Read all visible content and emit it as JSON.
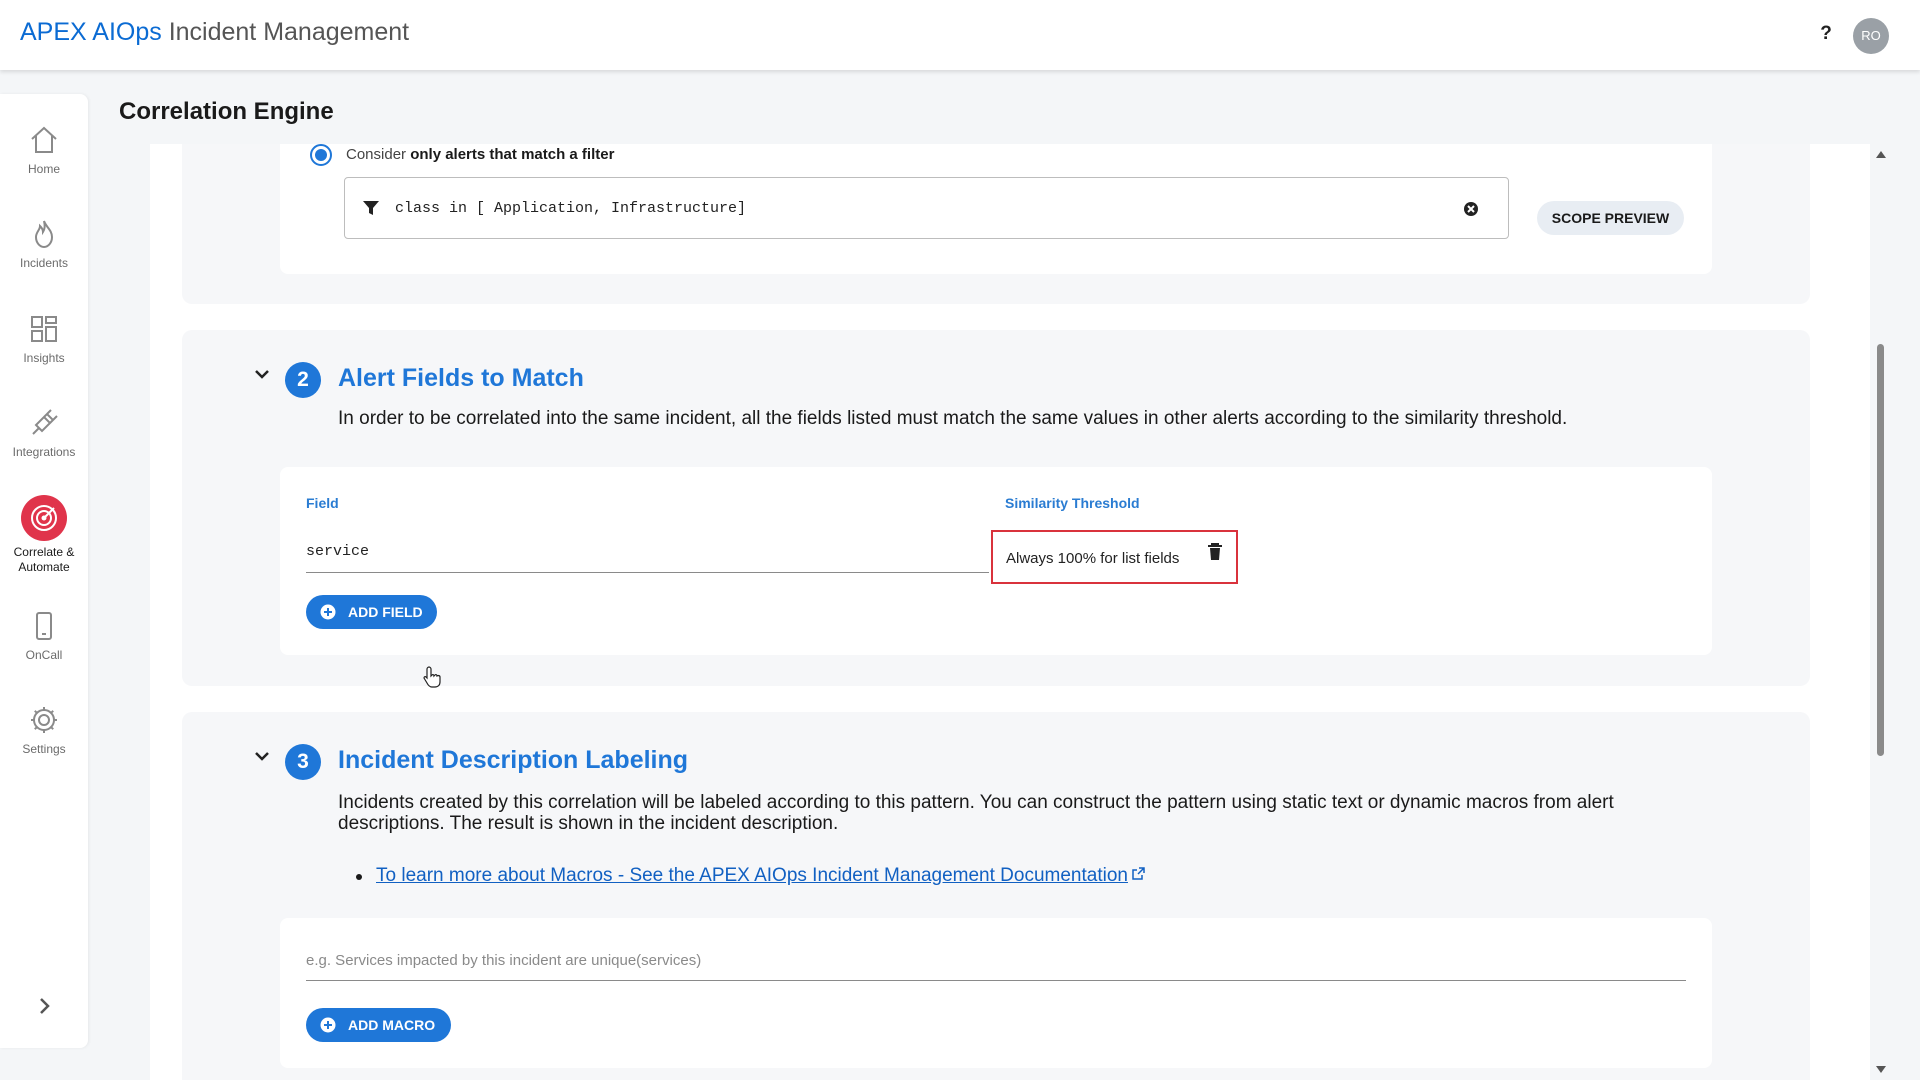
{
  "header": {
    "brand_primary": "APEX AIOps",
    "brand_secondary": " Incident Management",
    "help": "?",
    "avatar": "RO"
  },
  "sidebar": {
    "items": [
      {
        "label": "Home",
        "icon": "home-icon"
      },
      {
        "label": "Incidents",
        "icon": "flame-icon"
      },
      {
        "label": "Insights",
        "icon": "grid-icon"
      },
      {
        "label": "Integrations",
        "icon": "plug-icon"
      },
      {
        "label": "Correlate & Automate",
        "icon": "target-icon",
        "active": true
      },
      {
        "label": "OnCall",
        "icon": "phone-icon"
      },
      {
        "label": "Settings",
        "icon": "gear-icon"
      }
    ],
    "expand_icon": "chevron-right-icon"
  },
  "page": {
    "title": "Correlation Engine"
  },
  "scope": {
    "radio_prefix": "Consider ",
    "radio_bold": "only alerts that match a filter",
    "filter_value": "class in [ Application, Infrastructure]",
    "scope_preview": "SCOPE PREVIEW"
  },
  "section2": {
    "number": "2",
    "title": "Alert Fields to Match",
    "description": "In order to be correlated into the same incident, all the fields listed must match the same values in other alerts according to the similarity threshold.",
    "col_field": "Field",
    "col_threshold": "Similarity Threshold",
    "row": {
      "field": "service",
      "threshold": "Always 100% for list fields"
    },
    "add_field": "ADD FIELD"
  },
  "section3": {
    "number": "3",
    "title": "Incident Description Labeling",
    "description_line1": "Incidents created by this correlation will be labeled according to this pattern. You can construct the pattern using static text or dynamic macros from alert",
    "description_line2": "descriptions. The result is shown in the incident description.",
    "link": "To learn more about Macros - See the APEX AIOps Incident Management Documentation",
    "placeholder": "e.g. Services impacted by this incident are unique(services)",
    "add_macro": "ADD MACRO"
  },
  "colors": {
    "accent": "#1f77d8",
    "active_nav": "#e0344b",
    "highlight": "#d9323c"
  }
}
